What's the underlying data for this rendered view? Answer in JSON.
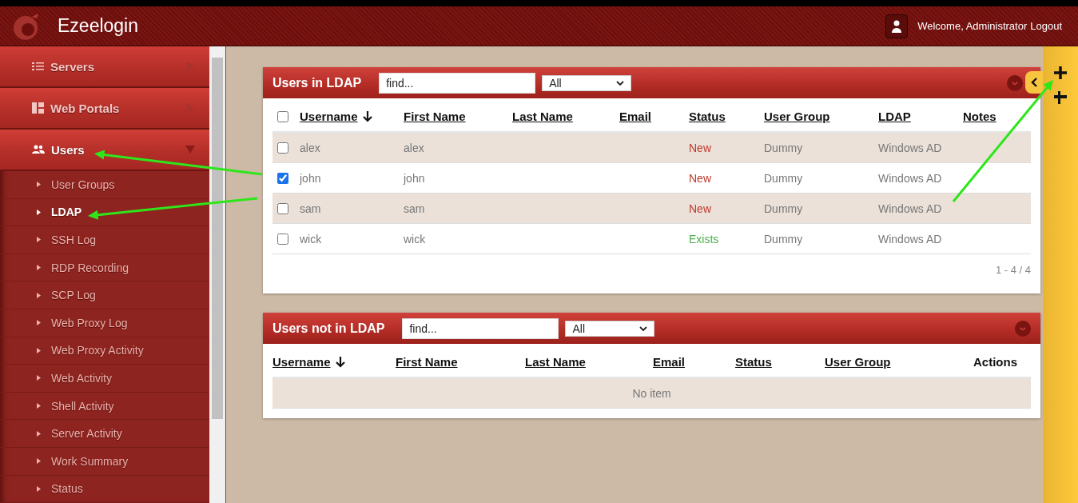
{
  "header": {
    "brand": "Ezeelogin",
    "welcome": "Welcome, Administrator",
    "logout": "Logout"
  },
  "sidebar": {
    "items": [
      {
        "kind": "main",
        "label": "Servers",
        "selected": false,
        "expanded": false
      },
      {
        "kind": "main",
        "label": "Web Portals",
        "selected": false,
        "expanded": false
      },
      {
        "kind": "main",
        "label": "Users",
        "selected": true,
        "expanded": true
      },
      {
        "kind": "sub",
        "label": "User Groups",
        "selected": false
      },
      {
        "kind": "sub",
        "label": "LDAP",
        "selected": true
      },
      {
        "kind": "sub",
        "label": "SSH Log",
        "selected": false
      },
      {
        "kind": "sub",
        "label": "RDP Recording",
        "selected": false
      },
      {
        "kind": "sub",
        "label": "SCP Log",
        "selected": false
      },
      {
        "kind": "sub",
        "label": "Web Proxy Log",
        "selected": false
      },
      {
        "kind": "sub",
        "label": "Web Proxy Activity",
        "selected": false
      },
      {
        "kind": "sub",
        "label": "Web Activity",
        "selected": false
      },
      {
        "kind": "sub",
        "label": "Shell Activity",
        "selected": false
      },
      {
        "kind": "sub",
        "label": "Server Activity",
        "selected": false
      },
      {
        "kind": "sub",
        "label": "Work Summary",
        "selected": false
      },
      {
        "kind": "sub",
        "label": "Status",
        "selected": false
      }
    ]
  },
  "panels": [
    {
      "title": "Users in LDAP",
      "search": {
        "placeholder": "find..."
      },
      "filter": "All",
      "select_all": {
        "checked": false
      },
      "columns": [
        {
          "label": "Username",
          "sortable": true,
          "sorted": true
        },
        {
          "label": "First Name",
          "sortable": true,
          "sorted": false
        },
        {
          "label": "Last Name",
          "sortable": true,
          "sorted": false
        },
        {
          "label": "Email",
          "sortable": true,
          "sorted": false
        },
        {
          "label": "Status",
          "sortable": true,
          "sorted": false
        },
        {
          "label": "User Group",
          "sortable": true,
          "sorted": false
        },
        {
          "label": "LDAP",
          "sortable": true,
          "sorted": false
        },
        {
          "label": "Notes",
          "sortable": true,
          "sorted": false
        }
      ],
      "rows": [
        {
          "checked": false,
          "cells": [
            "alex",
            "alex",
            "",
            "",
            "New",
            "Dummy",
            "Windows AD",
            ""
          ],
          "color": "#c0392b"
        },
        {
          "checked": true,
          "cells": [
            "john",
            "john",
            "",
            "",
            "New",
            "Dummy",
            "Windows AD",
            ""
          ],
          "color": "#c0392b"
        },
        {
          "checked": false,
          "cells": [
            "sam",
            "sam",
            "",
            "",
            "New",
            "Dummy",
            "Windows AD",
            ""
          ],
          "color": "#c0392b"
        },
        {
          "checked": false,
          "cells": [
            "wick",
            "wick",
            "",
            "",
            "Exists",
            "Dummy",
            "Windows AD",
            ""
          ],
          "color": "#4caf50"
        }
      ],
      "pager": "1 - 4 / 4"
    },
    {
      "title": "Users not in LDAP",
      "search": {
        "placeholder": "find..."
      },
      "filter": "All",
      "columns": [
        {
          "label": "Username",
          "sortable": true,
          "sorted": true
        },
        {
          "label": "First Name",
          "sortable": true,
          "sorted": false
        },
        {
          "label": "Last Name",
          "sortable": true,
          "sorted": false
        },
        {
          "label": "Email",
          "sortable": true,
          "sorted": false
        },
        {
          "label": "Status",
          "sortable": true,
          "sorted": false
        },
        {
          "label": "User Group",
          "sortable": true,
          "sorted": false
        },
        {
          "label": "Actions",
          "sortable": false,
          "sorted": false
        }
      ],
      "empty": "No item"
    }
  ]
}
